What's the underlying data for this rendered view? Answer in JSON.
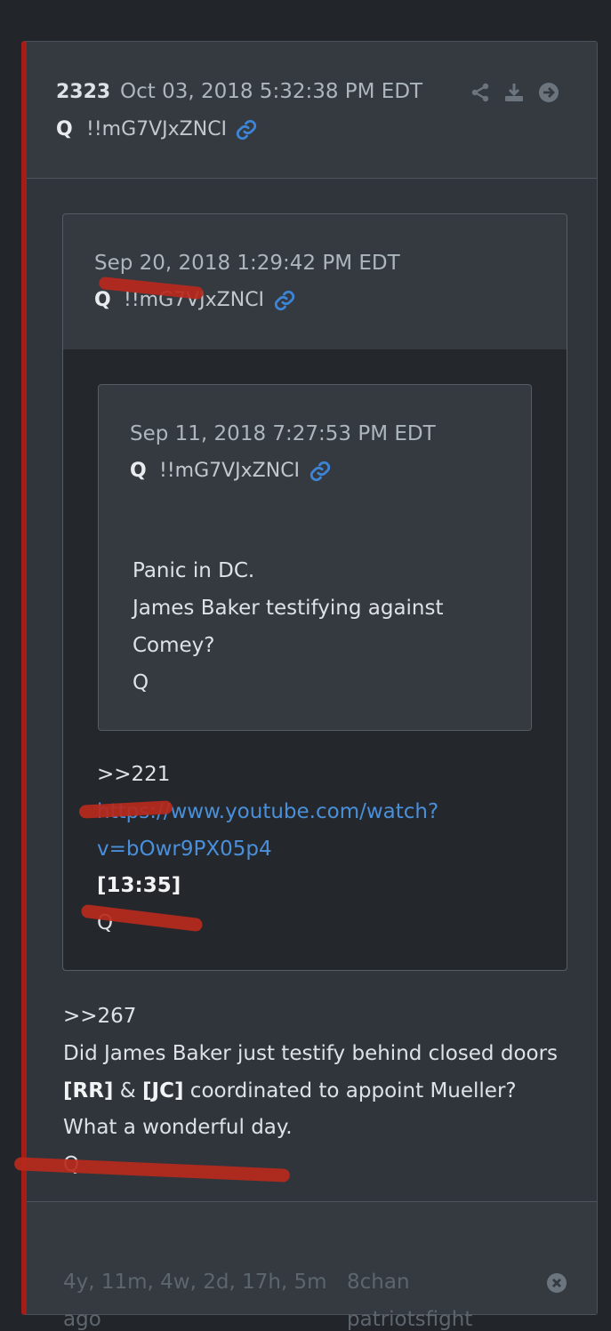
{
  "post": {
    "number": "2323",
    "date": "Oct 03, 2018 5:32:38 PM EDT",
    "author": "Q",
    "tripcode": "!!mG7VJxZNCI",
    "icons": [
      "share-icon",
      "download-icon",
      "arrow-right-circle-icon",
      "link-icon"
    ]
  },
  "quote1": {
    "date": "Sep 20, 2018 1:29:42 PM EDT",
    "author": "Q",
    "tripcode": "!!mG7VJxZNCI",
    "ref": ">>221",
    "url_line1": "https://www.youtube.com/watch?",
    "url_line2": "v=bOwr9PX05p4",
    "timestamp": "[13:35]",
    "sign": "Q"
  },
  "quote2": {
    "date": "Sep 11, 2018 7:27:53 PM EDT",
    "author": "Q",
    "tripcode": "!!mG7VJxZNCI",
    "lines": [
      "Panic in DC.",
      "James Baker testifying against",
      "Comey?",
      "Q"
    ]
  },
  "body": {
    "ref": ">>267",
    "line1": "Did James Baker just testify behind closed doors",
    "rr": "[RR]",
    "amp": " & ",
    "jc": "[JC]",
    "line2_rest": " coordinated to appoint Mueller?",
    "line3": "What a wonderful day.",
    "sign": "Q"
  },
  "footer": {
    "age_line1": "4y, 11m, 4w, 2d, 17h, 5m",
    "age_line2": "ago",
    "source_line1": "8chan",
    "source_line2": "patriotsfight",
    "close_icon": "close-circle-icon"
  },
  "colors": {
    "accent_red": "#a51d18",
    "link_blue": "#4a8fd9",
    "background": "#22252a",
    "card": "#343a40",
    "redaction_marker": "#b8291d"
  }
}
